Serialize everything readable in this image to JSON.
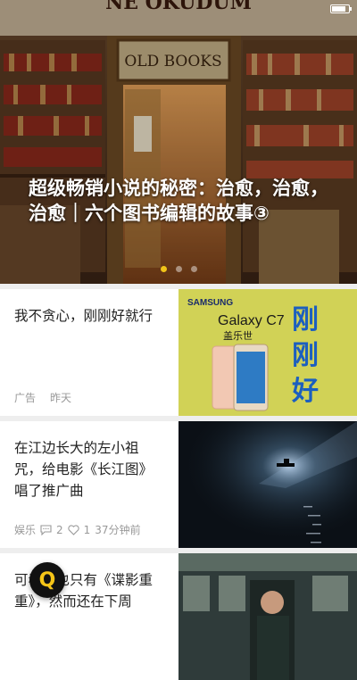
{
  "status_bar": {
    "left": "",
    "right": ""
  },
  "hero": {
    "store_sign": "NE OKUDUM",
    "shop_sign": "OLD BOOKS",
    "title": "超级畅销小说的秘密：治愈，治愈，治愈｜六个图书编辑的故事③",
    "pages": 3,
    "active_page": 1
  },
  "articles": [
    {
      "title": "我不贪心，刚刚好就行",
      "category": "广告",
      "time": "昨天",
      "ad": {
        "brand": "SAMSUNG",
        "model": "Galaxy C7",
        "sub": "盖乐世",
        "slogan": [
          "刚",
          "刚",
          "好"
        ]
      }
    },
    {
      "title": "在江边长大的左小祖咒，给电影《长江图》唱了推广曲",
      "category": "娱乐",
      "comments": "2",
      "likes": "1",
      "time": "37分钟前"
    },
    {
      "title": "可看的也只有《谍影重重》，然而还在下周",
      "category": "",
      "time": ""
    }
  ],
  "colors": {
    "accent": "#f0c419",
    "badge_bg": "#111111",
    "badge_fg": "#f5c518",
    "samsung_bg": "#f4d21a",
    "slogan": "#1c5fbf"
  },
  "badge": {
    "letter": "Q"
  }
}
